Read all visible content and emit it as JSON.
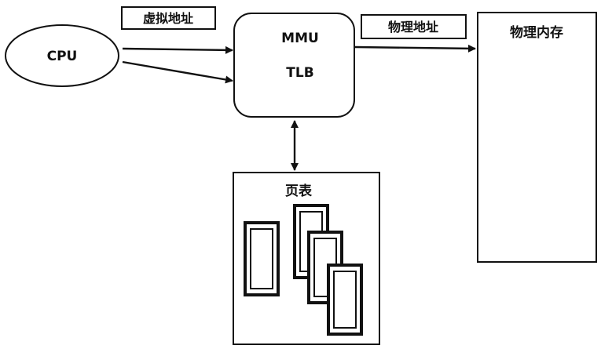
{
  "nodes": {
    "cpu": "CPU",
    "mmu": "MMU",
    "tlb": "TLB",
    "physical_memory": "物理内存",
    "page_table": "页表"
  },
  "edge_labels": {
    "virtual_address": "虚拟地址",
    "physical_address": "物理地址"
  }
}
